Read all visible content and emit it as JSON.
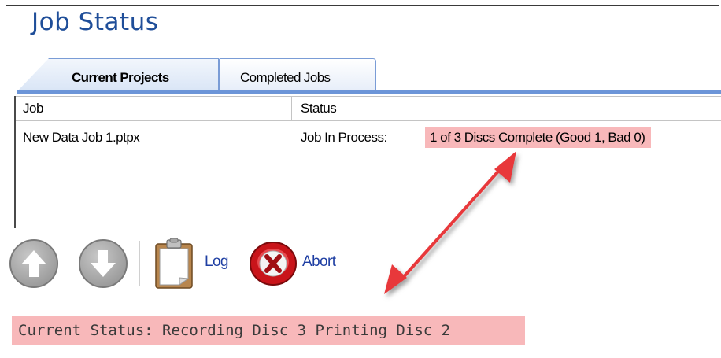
{
  "page": {
    "title": "Job Status"
  },
  "tabs": [
    {
      "label": "Current Projects",
      "active": true
    },
    {
      "label": "Completed Jobs",
      "active": false
    }
  ],
  "table": {
    "columns": [
      "Job",
      "Status"
    ],
    "rows": [
      {
        "job": "New Data Job 1.ptpx",
        "status_prefix": "Job In Process:",
        "status_detail": "1 of 3 Discs Complete (Good 1, Bad 0)"
      }
    ]
  },
  "toolbar": {
    "buttons": [
      {
        "name": "move-up",
        "icon": "up-arrow-icon",
        "label": ""
      },
      {
        "name": "move-down",
        "icon": "down-arrow-icon",
        "label": ""
      },
      {
        "name": "log",
        "icon": "clipboard-icon",
        "label": "Log"
      },
      {
        "name": "abort",
        "icon": "abort-x-icon",
        "label": "Abort"
      }
    ]
  },
  "status_bar": {
    "text": "Current Status: Recording Disc 3 Printing Disc 2"
  },
  "colors": {
    "title": "#1f4e99",
    "tab_border": "#7a9cd6",
    "highlight": "#f8b8ba",
    "annotation_arrow": "#e8383a",
    "link_text": "#1f3fa3"
  }
}
